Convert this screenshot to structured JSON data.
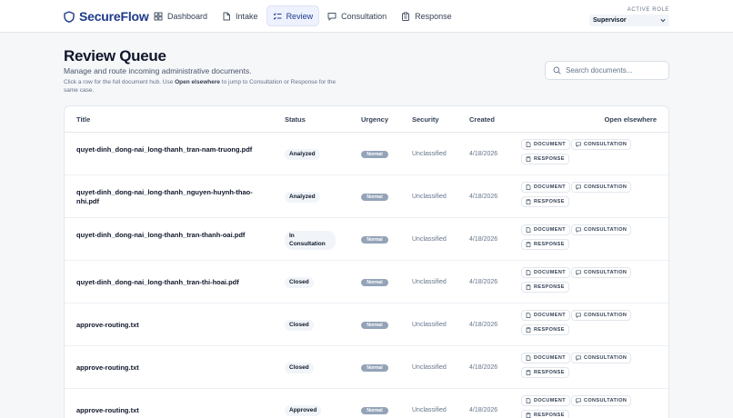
{
  "app": {
    "brand": "SecureFlow"
  },
  "nav": [
    {
      "label": "Dashboard",
      "icon": "grid-icon",
      "active": false
    },
    {
      "label": "Intake",
      "icon": "file-icon",
      "active": false
    },
    {
      "label": "Review",
      "icon": "list-check-icon",
      "active": true
    },
    {
      "label": "Consultation",
      "icon": "chat-icon",
      "active": false
    },
    {
      "label": "Response",
      "icon": "clipboard-icon",
      "active": false
    }
  ],
  "role": {
    "label": "ACTIVE ROLE",
    "value": "Supervisor"
  },
  "header": {
    "title": "Review Queue",
    "subtitle": "Manage and route incoming administrative documents.",
    "hint_prefix": "Click a row for the full document hub. Use ",
    "hint_bold": "Open elsewhere",
    "hint_suffix": " to jump to Consultation or Response for the same case."
  },
  "search": {
    "placeholder": "Search documents..."
  },
  "table": {
    "headers": {
      "title": "Title",
      "status": "Status",
      "urgency": "Urgency",
      "security": "Security",
      "created": "Created",
      "open": "Open elsewhere"
    },
    "actions": {
      "document": "DOCUMENT",
      "consultation": "CONSULTATION",
      "response": "RESPONSE"
    },
    "rows": [
      {
        "title": "quyet-dinh_dong-nai_long-thanh_tran-nam-truong.pdf",
        "status": "Analyzed",
        "urgency": "Normal",
        "security": "Unclassified",
        "created": "4/18/2026"
      },
      {
        "title": "quyet-dinh_dong-nai_long-thanh_nguyen-huynh-thao-nhi.pdf",
        "status": "Analyzed",
        "urgency": "Normal",
        "security": "Unclassified",
        "created": "4/18/2026"
      },
      {
        "title": "quyet-dinh_dong-nai_long-thanh_tran-thanh-oai.pdf",
        "status": "In Consultation",
        "urgency": "Normal",
        "security": "Unclassified",
        "created": "4/18/2026"
      },
      {
        "title": "quyet-dinh_dong-nai_long-thanh_tran-thi-hoai.pdf",
        "status": "Closed",
        "urgency": "Normal",
        "security": "Unclassified",
        "created": "4/18/2026"
      },
      {
        "title": "approve-routing.txt",
        "status": "Closed",
        "urgency": "Normal",
        "security": "Unclassified",
        "created": "4/18/2026"
      },
      {
        "title": "approve-routing.txt",
        "status": "Closed",
        "urgency": "Normal",
        "security": "Unclassified",
        "created": "4/18/2026"
      },
      {
        "title": "approve-routing.txt",
        "status": "Approved",
        "urgency": "Normal",
        "security": "Unclassified",
        "created": "4/18/2026"
      }
    ]
  }
}
